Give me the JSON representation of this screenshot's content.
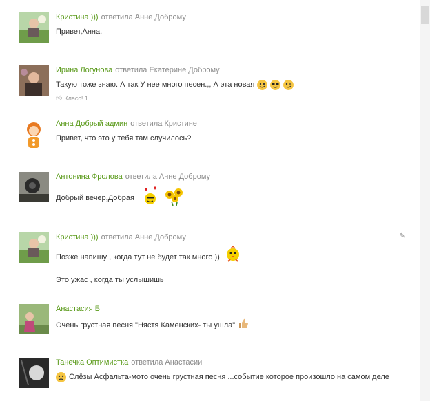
{
  "comments": [
    {
      "author": "Кристина )))",
      "replied": "ответила Анне Доброму",
      "text": "Привет,Анна.",
      "avatar": "avatar-kristina"
    },
    {
      "author": "Ирина Логунова",
      "replied": "ответила Екатерине Доброму",
      "text": "Такую тоже знаю. А так У нее много песен.,, А эта новая",
      "likes": "Класс! 1",
      "avatar": "avatar-irina"
    },
    {
      "author": "Анна Добрый админ",
      "replied": "ответила Кристине",
      "text": "Привет, что это у тебя там случилось?",
      "avatar": "avatar-anna"
    },
    {
      "author": "Антонина Фролова",
      "replied": "ответила Анне Доброму",
      "text": "Добрый вечер,Добрая",
      "avatar": "avatar-antonina"
    },
    {
      "author": "Кристина )))",
      "replied": "ответила Анне Доброму",
      "text": "Позже напишу , когда тут не будет так много ))",
      "text2": "Это ужас , когда ты услышишь",
      "avatar": "avatar-kristina"
    },
    {
      "author": "Анастасия Б",
      "replied": "",
      "text": "Очень грустная песня \"Нястя Каменских- ты ушла\"",
      "avatar": "avatar-anastasia"
    },
    {
      "author": "Танечка Оптимистка",
      "replied": "ответила Анастасии",
      "text": "Слёзы Асфальта-мото очень грустная песня ...событие которое произошло на самом деле",
      "avatar": "avatar-tanechka"
    }
  ],
  "colors": {
    "author": "#5a9a1a",
    "replied": "#8a8a8a",
    "text": "#333333"
  }
}
